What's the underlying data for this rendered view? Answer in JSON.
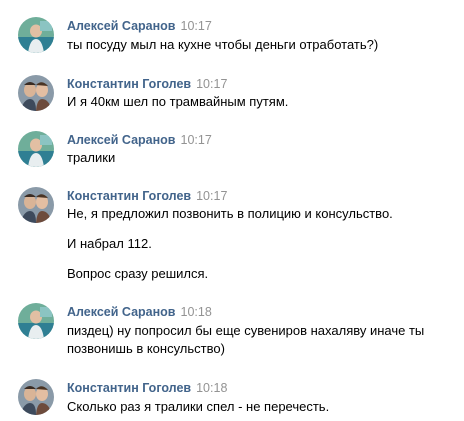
{
  "messages": [
    {
      "author": "Алексей Саранов",
      "time": "10:17",
      "avatar": "avatar-alexey",
      "lines": [
        "ты посуду мыл на кухне чтобы деньги отработать?)"
      ]
    },
    {
      "author": "Константин Гоголев",
      "time": "10:17",
      "avatar": "avatar-konstantin",
      "lines": [
        "И я 40км шел по трамвайным путям."
      ]
    },
    {
      "author": "Алексей Саранов",
      "time": "10:17",
      "avatar": "avatar-alexey",
      "lines": [
        "тралики"
      ]
    },
    {
      "author": "Константин Гоголев",
      "time": "10:17",
      "avatar": "avatar-konstantin",
      "lines": [
        "Не, я предложил позвонить в полицию и консульство.",
        "И набрал 112.",
        "Вопрос сразу решился."
      ]
    },
    {
      "author": "Алексей Саранов",
      "time": "10:18",
      "avatar": "avatar-alexey",
      "lines": [
        "пиздец) ну попросил бы еще сувениров нахаляву иначе ты позвонишь в консульство)"
      ]
    },
    {
      "author": "Константин Гоголев",
      "time": "10:18",
      "avatar": "avatar-konstantin",
      "lines": [
        "Сколько раз я тралики спел - не перечесть."
      ]
    }
  ],
  "colors": {
    "author": "#42648b",
    "time": "#939393",
    "text": "#000000",
    "background": "#ffffff"
  }
}
